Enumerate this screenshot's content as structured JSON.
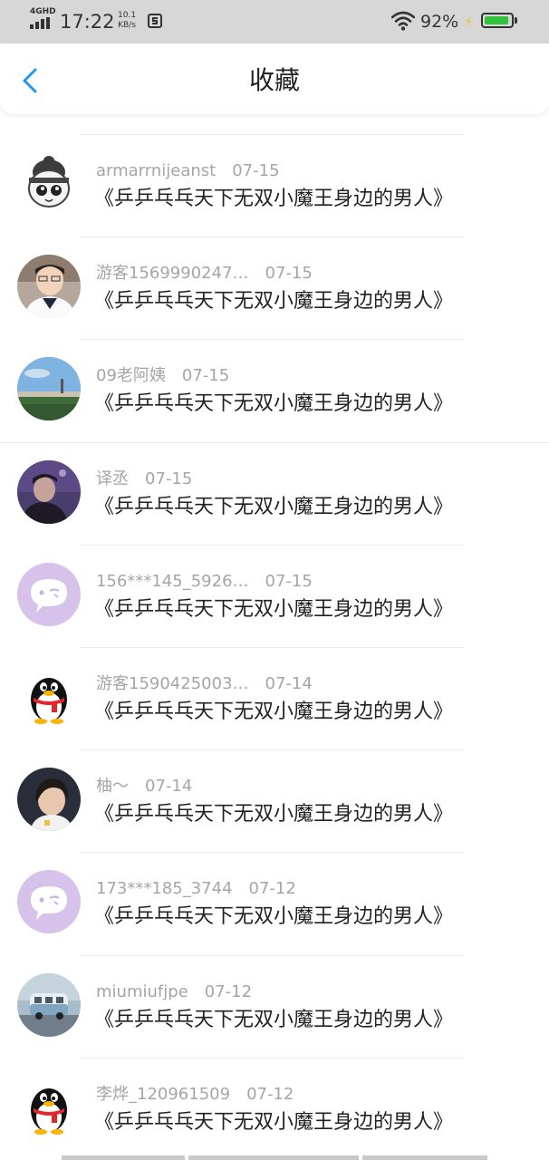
{
  "status_bar": {
    "network": "4GHD",
    "time": "17:22",
    "speed_value": "10.1",
    "speed_unit": "KB/s",
    "battery_percent": "92%",
    "battery_level": 0.92,
    "colors": {
      "battery": "#2fc43b",
      "charging": "#f1c232"
    }
  },
  "header": {
    "back_icon": "chevron-left-icon",
    "title": "收藏",
    "accent_color": "#2196f3"
  },
  "favorites": [
    {
      "name": "armarrnijeanst",
      "date": "07-15",
      "title": "《乒乒乓乓天下无双小魔王身边的男人》",
      "avatar": "cartoon-ninja-avatar"
    },
    {
      "name": "游客1569990247…",
      "date": "07-15",
      "title": "《乒乒乓乓天下无双小魔王身边的男人》",
      "avatar": "student-photo-avatar"
    },
    {
      "name": "09老阿姨",
      "date": "07-15",
      "title": "《乒乒乓乓天下无双小魔王身边的男人》",
      "avatar": "landscape-avatar"
    },
    {
      "name": "译丞",
      "date": "07-15",
      "title": "《乒乒乓乓天下无双小魔王身边的男人》",
      "avatar": "night-portrait-avatar"
    },
    {
      "name": "156***145_5926…",
      "date": "07-15",
      "title": "《乒乒乓乓天下无双小魔王身边的男人》",
      "avatar": "default-chat-avatar"
    },
    {
      "name": "游客1590425003…",
      "date": "07-14",
      "title": "《乒乒乓乓天下无双小魔王身边的男人》",
      "avatar": "qq-penguin-avatar"
    },
    {
      "name": "柚～",
      "date": "07-14",
      "title": "《乒乒乓乓天下无双小魔王身边的男人》",
      "avatar": "portrait-avatar"
    },
    {
      "name": "173***185_3744",
      "date": "07-12",
      "title": "《乒乒乓乓天下无双小魔王身边的男人》",
      "avatar": "default-chat-avatar"
    },
    {
      "name": "miumiufjpe",
      "date": "07-12",
      "title": "《乒乒乓乓天下无双小魔王身边的男人》",
      "avatar": "van-photo-avatar"
    },
    {
      "name": "李烨_120961509",
      "date": "07-12",
      "title": "《乒乒乓乓天下无双小魔王身边的男人》",
      "avatar": "qq-penguin-avatar"
    }
  ]
}
